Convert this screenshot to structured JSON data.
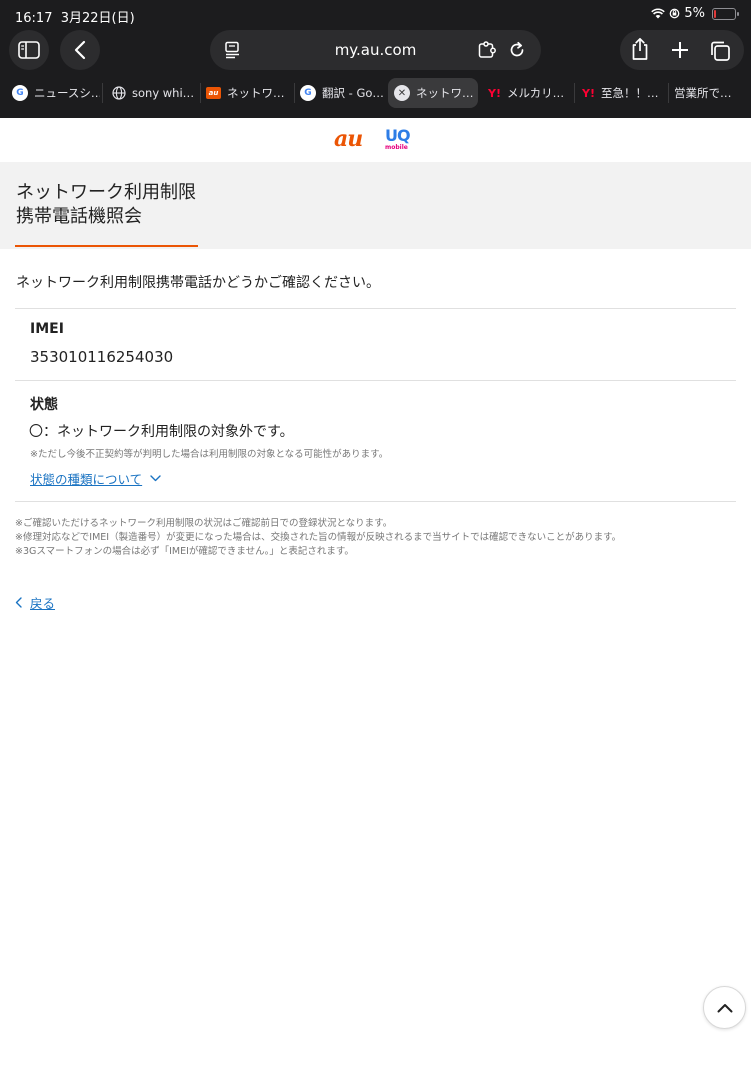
{
  "status_bar": {
    "time": "16:17",
    "date": "3月22日(日)",
    "battery": "5%",
    "battery_level": 0.05
  },
  "toolbar": {
    "url": "my.au.com",
    "icons": [
      "sidebar-icon",
      "back-icon",
      "reader-icon",
      "extension-icon",
      "reload-icon",
      "share-icon",
      "plus-icon",
      "tabs-icon"
    ]
  },
  "tabs": [
    {
      "title": "ニュースシ…",
      "favicon": "google-icon",
      "active": false
    },
    {
      "title": "sony whi…",
      "favicon": "globe-icon",
      "active": false
    },
    {
      "title": "ネットワ…",
      "favicon": "au-icon",
      "active": false
    },
    {
      "title": "翻訳 - Go…",
      "favicon": "google-icon",
      "active": false
    },
    {
      "title": "ネットワ…",
      "favicon": "close-icon",
      "active": true
    },
    {
      "title": "メルカリ…",
      "favicon": "yahoo-icon",
      "active": false
    },
    {
      "title": "至急！！…",
      "favicon": "yahoo-icon",
      "active": false
    },
    {
      "title": "営業所で…",
      "favicon": "",
      "active": false
    }
  ],
  "favicon_text": {
    "google": "G",
    "au": "au",
    "yahoo": "Y!",
    "close": "✕"
  },
  "logos": {
    "au": "au",
    "uq_main": "UQ",
    "uq_sub": "mobile"
  },
  "colors": {
    "au_orange": "#eb5505",
    "link_blue": "#1a73c2",
    "uq_blue": "#2d7de6",
    "uq_pink": "#e6007e"
  },
  "page": {
    "title_line1": "ネットワーク利用制限",
    "title_line2": "携帯電話機照会",
    "intro": "ネットワーク利用制限携帯電話かどうかご確認ください。",
    "imei_label": "IMEI",
    "imei_value": "353010116254030",
    "status_label": "状態",
    "status_value": "〇：ネットワーク利用制限の対象外です。",
    "status_note": "※ただし今後不正契約等が判明した場合は利用制限の対象となる可能性があります。",
    "status_types_link": "状態の種類について",
    "footnotes": [
      "※ご確認いただけるネットワーク利用制限の状況はご確認前日での登録状況となります。",
      "※修理対応などでIMEI（製造番号）が変更になった場合は、交換された旨の情報が反映されるまで当サイトでは確認できないことがあります。",
      "※3Gスマートフォンの場合は必ず「IMEIが確認できません。」と表記されます。"
    ],
    "back_link": "戻る"
  }
}
